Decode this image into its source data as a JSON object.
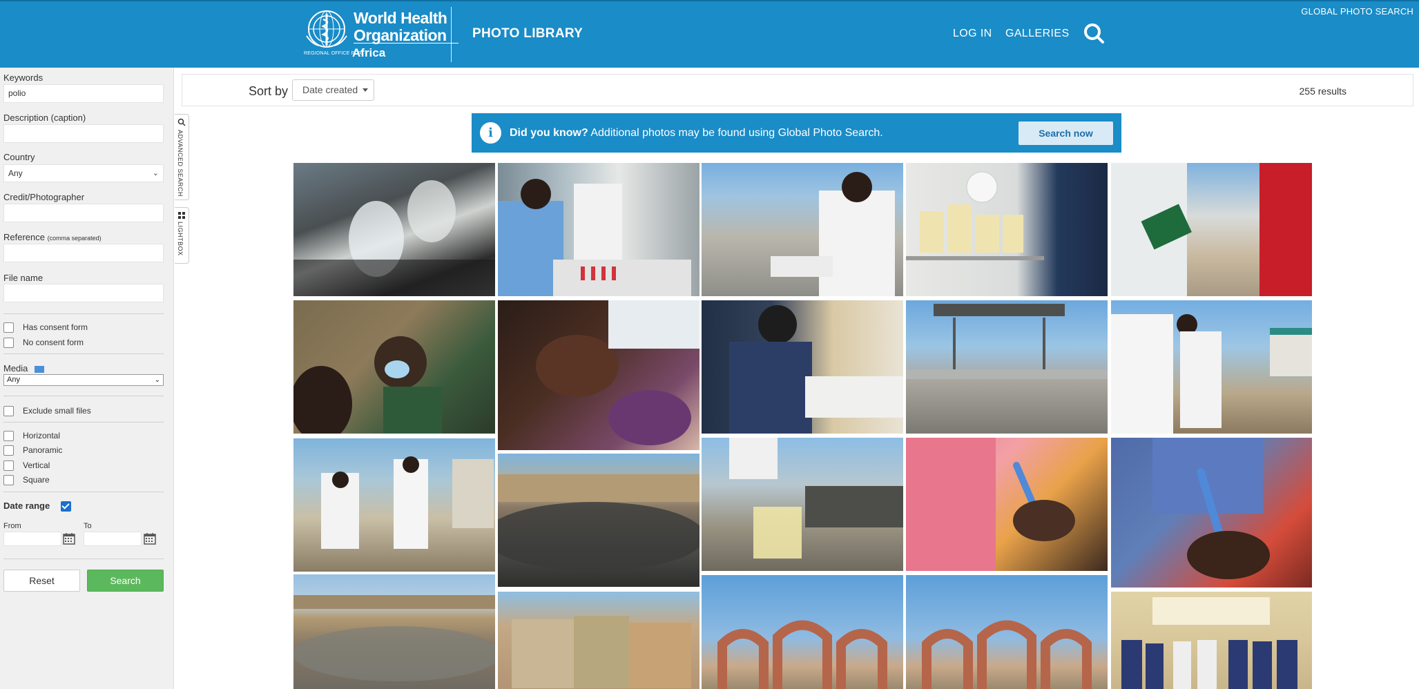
{
  "header": {
    "logo_line1": "World Health",
    "logo_line2": "Organization",
    "logo_sub": "REGIONAL OFFICE FOR",
    "logo_africa": "Africa",
    "title": "PHOTO LIBRARY",
    "nav_login": "LOG IN",
    "nav_galleries": "GALLERIES",
    "global_link": "GLOBAL PHOTO SEARCH",
    "search_icon": "search-icon",
    "brand_color": "#1a8cc7"
  },
  "sidebar": {
    "keywords_label": "Keywords",
    "keywords_value": "polio",
    "description_label": "Description (caption)",
    "description_value": "",
    "country_label": "Country",
    "country_value": "Any",
    "credit_label": "Credit/Photographer",
    "credit_value": "",
    "reference_label": "Reference",
    "reference_hint": "(comma separated)",
    "reference_value": "",
    "filename_label": "File name",
    "filename_value": "",
    "consent": [
      "Has consent form",
      "No consent form"
    ],
    "media_label": "Media",
    "media_value": "Any",
    "exclude_small": "Exclude small files",
    "orientations": [
      "Horizontal",
      "Panoramic",
      "Vertical",
      "Square"
    ],
    "date_range_label": "Date range",
    "from_label": "From",
    "to_label": "To",
    "reset_label": "Reset",
    "search_label": "Search",
    "search_color": "#5cb85c"
  },
  "side_tabs": {
    "advanced": "ADVANCED SEARCH",
    "lightbox": "LIGHTBOX"
  },
  "results": {
    "sort_label": "Sort by",
    "sort_value": "Date created",
    "count": "255 results"
  },
  "banner": {
    "icon": "info-icon",
    "lead": "Did you know?",
    "text": " Additional photos may be found using Global Photo Search.",
    "button": "Search now"
  },
  "photos": [
    {
      "name": "photo-lab-pouring"
    },
    {
      "name": "photo-lab-microscope"
    },
    {
      "name": "photo-clipboard-site"
    },
    {
      "name": "photo-fridge-samples"
    },
    {
      "name": "photo-fuel-pump"
    },
    {
      "name": "photo-child-masked"
    },
    {
      "name": "photo-oral-vaccine"
    },
    {
      "name": "photo-desk-papers"
    },
    {
      "name": "photo-water-works"
    },
    {
      "name": "photo-sampling-kit"
    },
    {
      "name": "photo-sampling-crouch"
    },
    {
      "name": "photo-waste-field"
    },
    {
      "name": "photo-sample-jar"
    },
    {
      "name": "photo-finger-mark-1"
    },
    {
      "name": "photo-finger-mark-2"
    },
    {
      "name": "photo-waste-landscape"
    },
    {
      "name": "photo-village-walls"
    },
    {
      "name": "photo-city-gate-1"
    },
    {
      "name": "photo-city-gate-2"
    },
    {
      "name": "photo-health-team"
    }
  ]
}
